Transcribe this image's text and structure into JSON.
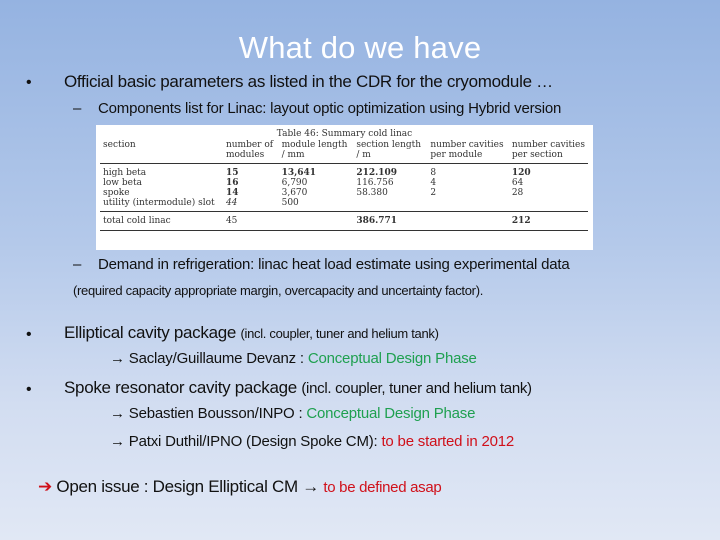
{
  "slide": {
    "title": "What do we have",
    "bullets": {
      "b1": {
        "marker": "•",
        "text": "Official basic parameters as listed in the CDR for the cryomodule …",
        "sub1": {
          "marker": "–",
          "text": "Components list for Linac: layout optic optimization using Hybrid version"
        },
        "sub2": {
          "marker": "–",
          "text": "Demand in refrigeration: linac heat load estimate using experimental data",
          "note": "(required capacity appropriate margin, overcapacity and uncertainty factor)."
        }
      },
      "b2": {
        "marker": "•",
        "text": "Elliptical cavity package",
        "detail": "(incl. coupler, tuner and helium tank)",
        "items": [
          {
            "arrow": "→",
            "who": "Saclay/Guillaume Devanz : ",
            "status": "Conceptual Design Phase",
            "status_color": "#1fa050"
          }
        ]
      },
      "b3": {
        "marker": "•",
        "text": "Spoke resonator cavity package",
        "detail": "(incl. coupler, tuner and helium tank)",
        "items": [
          {
            "arrow": "→",
            "who": "Sebastien Bousson/INPO : ",
            "status": "Conceptual Design Phase",
            "status_color": "#1fa050"
          },
          {
            "arrow": "→",
            "who": "Patxi Duthil/IPNO (Design Spoke CM): ",
            "status": "to be started in 2012",
            "status_color": "#d0101a"
          }
        ]
      },
      "open_issue": {
        "arrow": "➔",
        "arrow_color": "#d0101a",
        "text": "Open issue : Design Elliptical CM ",
        "arrow2": "→",
        "status": "to be defined asap",
        "status_color": "#d0101a"
      }
    }
  },
  "table": {
    "caption": "Table 46: Summary cold linac",
    "headers": [
      [
        "section",
        ""
      ],
      [
        "number of",
        "modules"
      ],
      [
        "module length",
        "/ mm"
      ],
      [
        "section length",
        "/ m"
      ],
      [
        "number cavities",
        "per module"
      ],
      [
        "number cavities",
        "per section"
      ]
    ],
    "rows": [
      [
        "high beta",
        "15",
        "13,641",
        "212.109",
        "8",
        "120"
      ],
      [
        "low beta",
        "16",
        "6,790",
        "116.756",
        "4",
        "64"
      ],
      [
        "spoke",
        "14",
        "3,670",
        "58.380",
        "2",
        "28"
      ],
      [
        "utility (intermodule) slot",
        "44",
        "500",
        "",
        "",
        ""
      ]
    ],
    "total": [
      "total cold linac",
      "45",
      "",
      "386.771",
      "",
      "212"
    ]
  }
}
